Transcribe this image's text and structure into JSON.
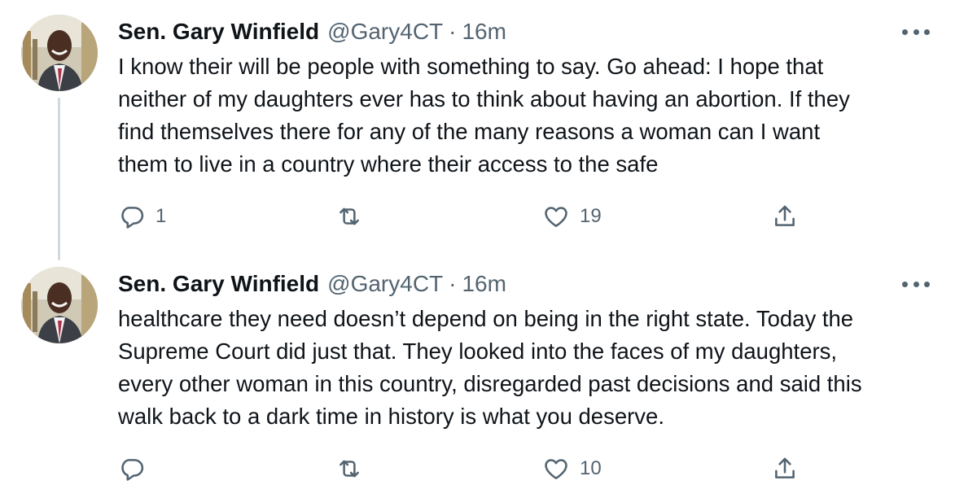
{
  "tweets": [
    {
      "name": "Sen. Gary Winfield",
      "handle": "@Gary4CT",
      "separator": "·",
      "time": "16m",
      "lines": [
        "I know their will be people with something to say. Go ahead: I hope that",
        "neither of my daughters ever has to think about having an abortion. If they",
        "find themselves there for any of the many reasons a woman can I want",
        "them to live in a country where their access to the safe"
      ],
      "replies": "1",
      "retweets": "",
      "likes": "19"
    },
    {
      "name": "Sen. Gary Winfield",
      "handle": "@Gary4CT",
      "separator": "·",
      "time": "16m",
      "lines": [
        "healthcare they need doesn’t depend on being in the right state. Today the",
        "Supreme Court did just that. They looked into the faces of my daughters,",
        "every other woman in this country, disregarded past decisions and said this",
        "walk back to a dark time in history is what you deserve."
      ],
      "replies": "",
      "retweets": "",
      "likes": "10"
    }
  ],
  "icons": {
    "reply": "reply-icon",
    "retweet": "retweet-icon",
    "like": "heart-icon",
    "share": "share-icon",
    "more": "more-icon"
  }
}
